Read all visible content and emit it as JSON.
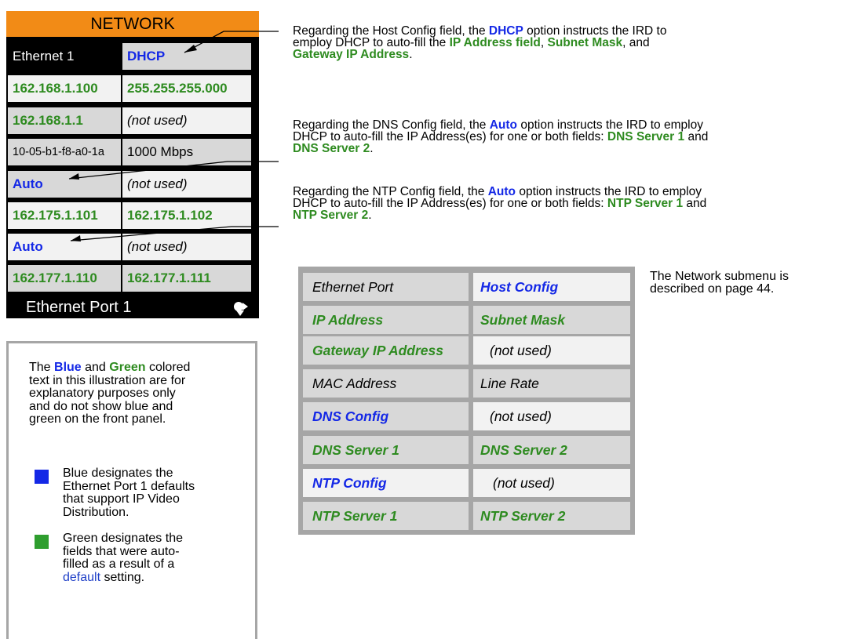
{
  "panel": {
    "title": "NETWORK",
    "footer": "Ethernet Port 1",
    "rows": [
      [
        "Ethernet 1",
        "DHCP"
      ],
      [
        "162.168.1.100",
        "255.255.255.000"
      ],
      [
        "162.168.1.1",
        "(not used)"
      ],
      [
        "10-05-b1-f8-a0-1a",
        "1000 Mbps"
      ],
      [
        "Auto",
        "(not used)"
      ],
      [
        "162.175.1.101",
        "162.175.1.102"
      ],
      [
        "Auto",
        "(not used)"
      ],
      [
        "162.177.1.110",
        "162.177.1.111"
      ]
    ]
  },
  "notes": {
    "host": {
      "a": "Regarding the Host Config field, the ",
      "b": "DHCP",
      "c": " option instructs the IRD to",
      "d": "employ DHCP to auto-fill the ",
      "e": "IP Address field",
      "f": ", ",
      "g": "Subnet Mask",
      "h": ", and",
      "i": "Gateway IP Address",
      "j": "."
    },
    "dns": {
      "a": "Regarding the DNS Config field, the ",
      "b": "Auto",
      "c": " option instructs the IRD to employ",
      "d": "DHCP to auto-fill the IP Address(es) for one or both fields: ",
      "e": "DNS Server 1",
      "f": " and",
      "g": "DNS Server 2",
      "h": "."
    },
    "ntp": {
      "a": "Regarding the NTP Config field, the ",
      "b": "Auto",
      "c": " option instructs the IRD to employ",
      "d": "DHCP to auto-fill the IP Address(es) for one or both fields: ",
      "e": "NTP Server 1",
      "f": " and",
      "g": "NTP Server 2",
      "h": "."
    },
    "submenu_line1": "The Network submenu is",
    "submenu_line2": "described on page 44."
  },
  "structure_table": [
    [
      "Ethernet Port",
      "Host Config"
    ],
    [
      "IP Address",
      "Subnet Mask"
    ],
    [
      "Gateway IP Address",
      "(not used)"
    ],
    [
      "MAC Address",
      "Line Rate"
    ],
    [
      "DNS Config",
      "(not used)"
    ],
    [
      "DNS Server 1",
      "DNS Server 2"
    ],
    [
      "NTP Config",
      "(not used)"
    ],
    [
      "NTP Server 1",
      "NTP Server 2"
    ]
  ],
  "legend": {
    "intro": {
      "a": "The ",
      "b": "Blue",
      "c": " and ",
      "d": "Green",
      "e": " colored",
      "l2": "text in this illustration are for",
      "l3": "explanatory purposes only",
      "l4": "and do not show blue and",
      "l5": "green on the front panel."
    },
    "blue_lines": [
      "Blue designates the",
      "Ethernet Port 1 defaults",
      "that support IP Video",
      "Distribution."
    ],
    "green_lines": [
      "Green designates the",
      "fields that were auto-",
      "filled as a result of a"
    ],
    "green_link": "default",
    "green_tail": " setting."
  },
  "colors": {
    "blue": "#1428e6",
    "green": "#2e8b20",
    "orange": "#f28b16",
    "link": "#2040c8"
  }
}
